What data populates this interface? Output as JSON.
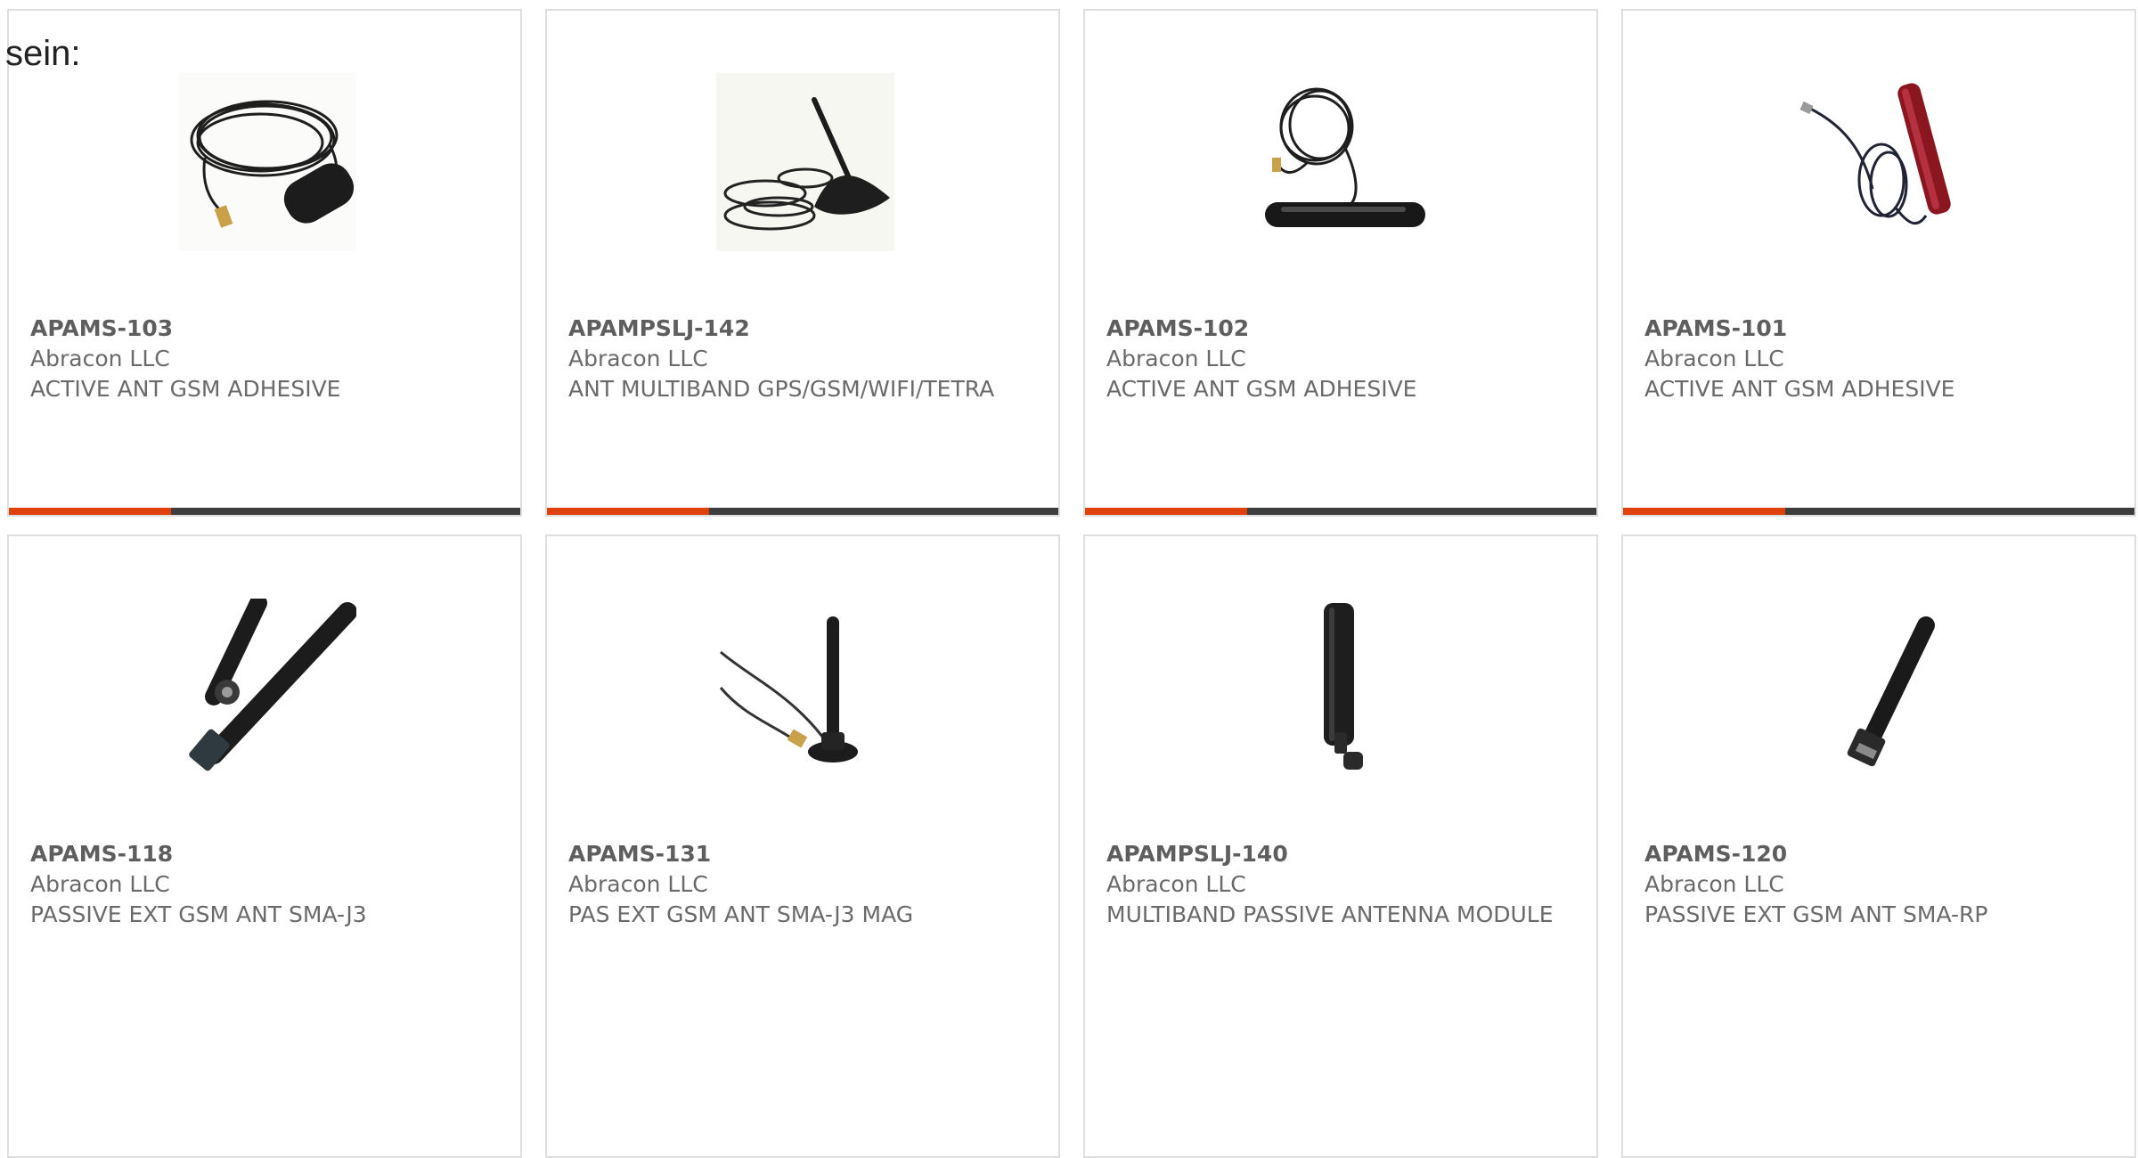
{
  "intro_text": "sein:",
  "colors": {
    "accent": "#e0400a",
    "bar": "#3d3d3d",
    "border": "#dedede",
    "text": "#6a6a6a"
  },
  "products": [
    {
      "part_number": "APAMS-103",
      "manufacturer": "Abracon LLC",
      "description": "ACTIVE ANT GSM ADHESIVE",
      "image": "adhesive-antenna-with-coiled-cable"
    },
    {
      "part_number": "APAMPSLJ-142",
      "manufacturer": "Abracon LLC",
      "description": "ANT MULTIBAND GPS/GSM/WIFI/TETRA",
      "image": "multiband-shark-fin-antenna-with-cables"
    },
    {
      "part_number": "APAMS-102",
      "manufacturer": "Abracon LLC",
      "description": "ACTIVE ANT GSM ADHESIVE",
      "image": "flat-bar-antenna-with-coiled-cable"
    },
    {
      "part_number": "APAMS-101",
      "manufacturer": "Abracon LLC",
      "description": "ACTIVE ANT GSM ADHESIVE",
      "image": "red-stick-antenna-with-cable"
    },
    {
      "part_number": "APAMS-118",
      "manufacturer": "Abracon LLC",
      "description": "PASSIVE EXT GSM ANT SMA-J3",
      "image": "hinged-rubber-duck-antenna"
    },
    {
      "part_number": "APAMS-131",
      "manufacturer": "Abracon LLC",
      "description": "PAS EXT GSM ANT SMA-J3 MAG",
      "image": "magnetic-base-whip-antenna"
    },
    {
      "part_number": "APAMPSLJ-140",
      "manufacturer": "Abracon LLC",
      "description": "MULTIBAND PASSIVE ANTENNA MODULE",
      "image": "paddle-antenna-with-hinge"
    },
    {
      "part_number": "APAMS-120",
      "manufacturer": "Abracon LLC",
      "description": "PASSIVE EXT GSM ANT SMA-RP",
      "image": "straight-rubber-duck-antenna"
    }
  ]
}
